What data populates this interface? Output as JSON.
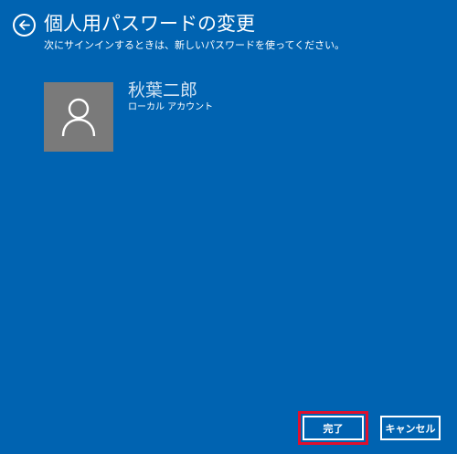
{
  "header": {
    "back_icon": "back-arrow-icon",
    "title": "個人用パスワードの変更",
    "subtitle": "次にサインインするときは、新しいパスワードを使ってください。"
  },
  "account": {
    "avatar_icon": "person-icon",
    "name": "秋葉二郎",
    "type": "ローカル アカウント"
  },
  "footer": {
    "finish_label": "完了",
    "cancel_label": "キャンセル",
    "highlight_color": "#e0102e"
  },
  "colors": {
    "background": "#0063b1",
    "avatar_background": "#7a7a7a",
    "text": "#ffffff"
  }
}
